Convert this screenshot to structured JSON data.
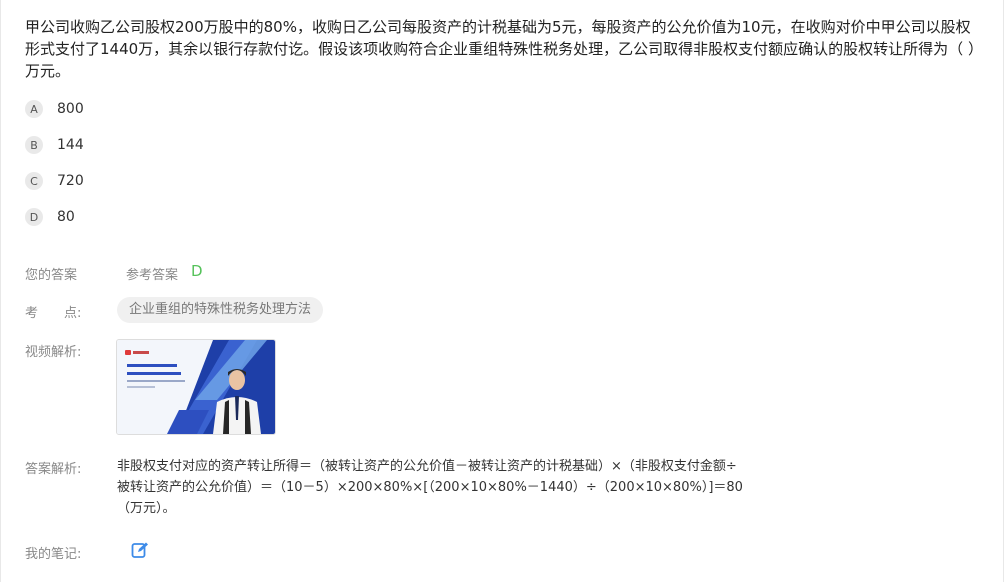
{
  "question": {
    "stem": "甲公司收购乙公司股权200万股中的80%，收购日乙公司每股资产的计税基础为5元，每股资产的公允价值为10元，在收购对价中甲公司以股权形式支付了1440万，其余以银行存款付讫。假设该项收购符合企业重组特殊性税务处理，乙公司取得非股权支付额应确认的股权转让所得为（ ）万元。"
  },
  "options": [
    {
      "letter": "A",
      "text": "800"
    },
    {
      "letter": "B",
      "text": "144"
    },
    {
      "letter": "C",
      "text": "720"
    },
    {
      "letter": "D",
      "text": "80"
    }
  ],
  "answer": {
    "your_answer_label": "您的答案",
    "your_answer_value": "",
    "reference_label": "参考答案",
    "reference_value": "D"
  },
  "knowledge_point": {
    "label": "考　　点:",
    "tag": "企业重组的特殊性税务处理方法"
  },
  "video": {
    "label": "视频解析:",
    "thumb_logo": "",
    "thumb_title_line1": "",
    "thumb_title_line2": ""
  },
  "analysis": {
    "label": "答案解析:",
    "lines": [
      "非股权支付对应的资产转让所得＝（被转让资产的公允价值－被转让资产的计税基础）×（非股权支付金额÷",
      "被转让资产的公允价值）＝（10－5）×200×80%×[（200×10×80%－1440）÷（200×10×80%）]＝80",
      "（万元）。"
    ]
  },
  "notes": {
    "label": "我的笔记:",
    "icon": "edit-note-icon"
  },
  "colors": {
    "accent_green": "#55c25a",
    "note_icon_blue": "#3d8be8",
    "tag_bg": "#f0f0f0",
    "thumb_blue_dark": "#1e3fa8",
    "thumb_blue_light": "#6ea3e8"
  }
}
